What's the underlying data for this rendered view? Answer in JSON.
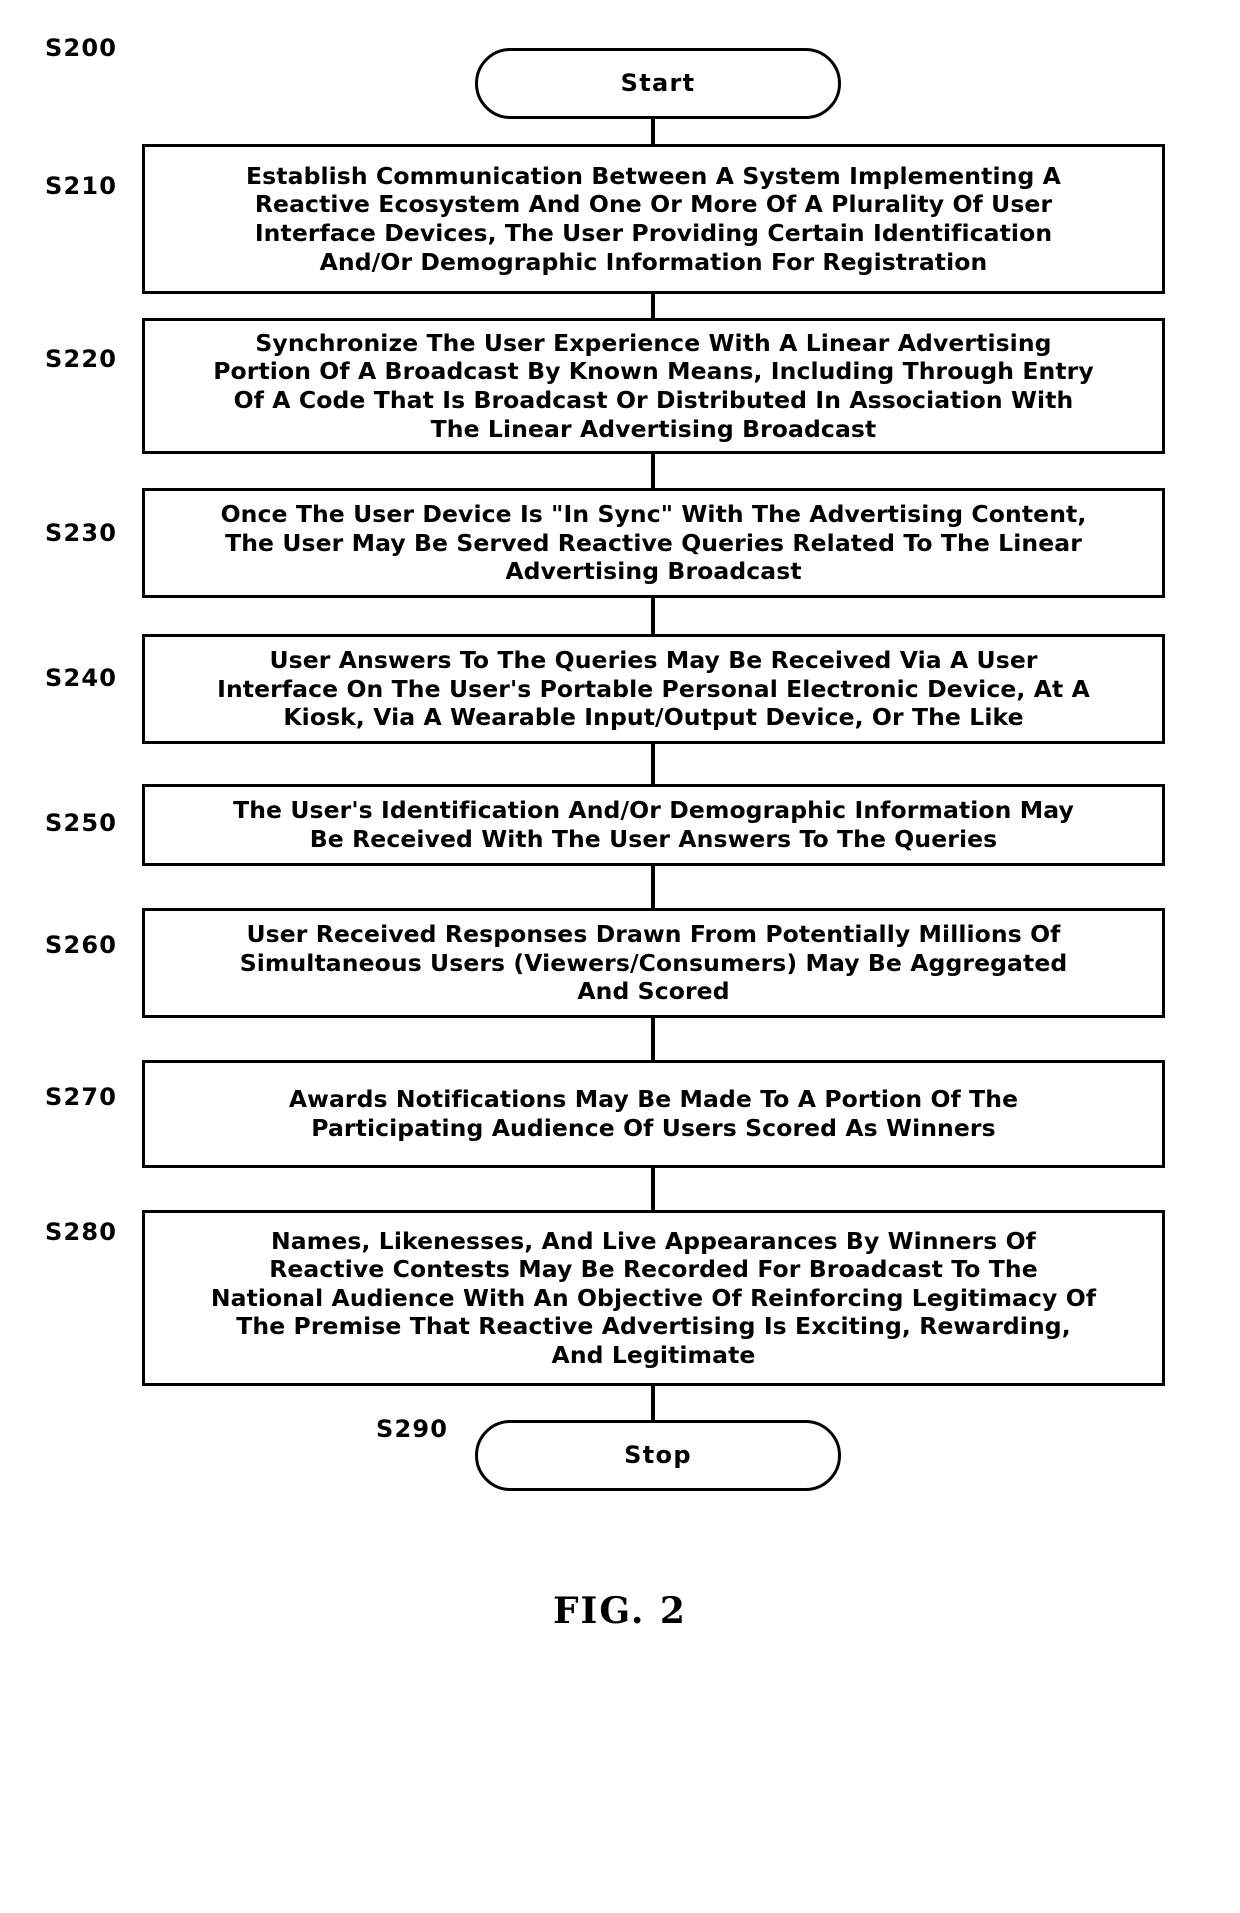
{
  "figure": {
    "caption": "FIG. 2",
    "title": "FIG. 2"
  },
  "colors": {
    "stroke": "#000000",
    "fill": "#ffffff",
    "text": "#000000"
  },
  "nodes": {
    "start": {
      "ref": "S200",
      "label": "Start",
      "shape": "terminator"
    },
    "s210": {
      "ref": "S210",
      "label": "Establish Communication Between A System Implementing A\nReactive Ecosystem And One Or More Of A Plurality Of User\nInterface Devices, The User Providing Certain Identification\nAnd/Or Demographic Information For Registration",
      "shape": "process"
    },
    "s220": {
      "ref": "S220",
      "label": "Synchronize The User Experience With A Linear Advertising\nPortion Of A Broadcast By Known Means, Including Through Entry\nOf A Code That Is Broadcast Or Distributed In Association With\nThe Linear Advertising Broadcast",
      "shape": "process"
    },
    "s230": {
      "ref": "S230",
      "label": "Once The User Device Is \"In Sync\" With The Advertising Content,\nThe User May Be Served Reactive Queries Related To The Linear\nAdvertising Broadcast",
      "shape": "process"
    },
    "s240": {
      "ref": "S240",
      "label": "User Answers To The Queries May Be Received Via A User\nInterface On The User's Portable Personal Electronic Device, At A\nKiosk, Via A Wearable Input/Output Device, Or The Like",
      "shape": "process"
    },
    "s250": {
      "ref": "S250",
      "label": "The User's Identification And/Or Demographic Information May\nBe Received With The User Answers To The Queries",
      "shape": "process"
    },
    "s260": {
      "ref": "S260",
      "label": "User Received Responses Drawn From Potentially Millions Of\nSimultaneous Users (Viewers/Consumers) May Be Aggregated\nAnd Scored",
      "shape": "process"
    },
    "s270": {
      "ref": "S270",
      "label": "Awards Notifications May Be Made To A Portion Of The\nParticipating Audience Of Users Scored As Winners",
      "shape": "process"
    },
    "s280": {
      "ref": "S280",
      "label": "Names, Likenesses, And Live Appearances By Winners Of\nReactive Contests May Be Recorded For Broadcast To The\nNational Audience With An Objective Of Reinforcing Legitimacy Of\nThe Premise That Reactive Advertising Is Exciting, Rewarding,\nAnd Legitimate",
      "shape": "process"
    },
    "stop": {
      "ref": "S290",
      "label": "Stop",
      "shape": "terminator"
    }
  }
}
